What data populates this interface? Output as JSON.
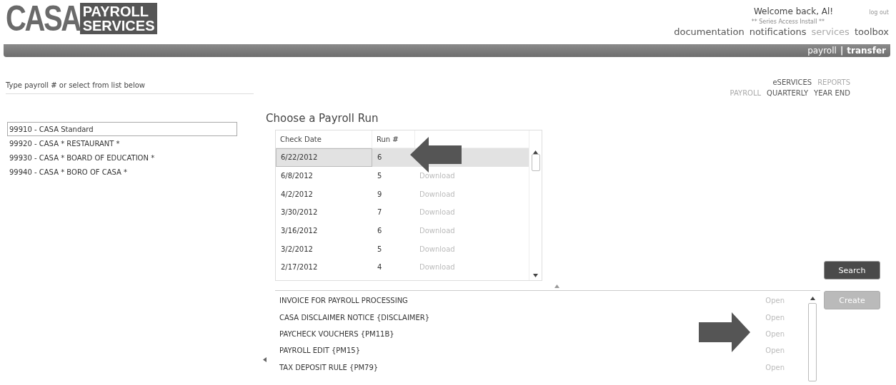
{
  "logo": {
    "main": "CASA",
    "line_1": "PAYROLL",
    "line_2": "SERVICES"
  },
  "header": {
    "welcome": "Welcome back, Al!",
    "logout": "log out",
    "notice": "** Series Access Install **",
    "nav": [
      "documentation",
      "notifications",
      "services",
      "toolbox"
    ],
    "band_links": [
      {
        "label": "payroll",
        "selected": false
      },
      {
        "label": "transfer",
        "selected": true
      }
    ],
    "band_separator": "|"
  },
  "payroll_picker": {
    "label": "Type payroll # or select from list below",
    "items": [
      {
        "label": "99910 - CASA Standard",
        "selected": true
      },
      {
        "label": "99920 - CASA * RESTAURANT *",
        "selected": false
      },
      {
        "label": "99930 - CASA * BOARD OF EDUCATION *",
        "selected": false
      },
      {
        "label": "99940 - CASA * BORO OF CASA *",
        "selected": false
      }
    ]
  },
  "top_links": {
    "row_1": [
      "eSERVICES",
      "REPORTS"
    ],
    "row_2": [
      "PAYROLL",
      "QUARTERLY",
      "YEAR END"
    ]
  },
  "runs": {
    "title": "Choose a Payroll Run",
    "columns": [
      "Check Date",
      "Run #"
    ],
    "rows": [
      {
        "date": "6/22/2012",
        "run": "6",
        "selected": true
      },
      {
        "date": "6/8/2012",
        "run": "5",
        "download": "Download",
        "selected": false
      },
      {
        "date": "4/2/2012",
        "run": "9",
        "download": "Download",
        "selected": false
      },
      {
        "date": "3/30/2012",
        "run": "7",
        "download": "Download",
        "selected": false
      },
      {
        "date": "3/16/2012",
        "run": "6",
        "download": "Download",
        "selected": false
      },
      {
        "date": "3/2/2012",
        "run": "5",
        "download": "Download",
        "selected": false
      },
      {
        "date": "2/17/2012",
        "run": "4",
        "download": "Download",
        "selected": false
      }
    ]
  },
  "reports": [
    {
      "name": "INVOICE FOR PAYROLL PROCESSING",
      "action": "Open"
    },
    {
      "name": "CASA DISCLAIMER NOTICE {DISCLAIMER}",
      "action": "Open"
    },
    {
      "name": "PAYCHECK VOUCHERS {PM11B}",
      "action": "Open"
    },
    {
      "name": "PAYROLL EDIT {PM15}",
      "action": "Open"
    },
    {
      "name": "TAX DEPOSIT RULE {PM79}",
      "action": "Open"
    }
  ],
  "buttons": [
    {
      "label": "Search",
      "disabled": false
    },
    {
      "label": "Create",
      "disabled": true
    }
  ]
}
